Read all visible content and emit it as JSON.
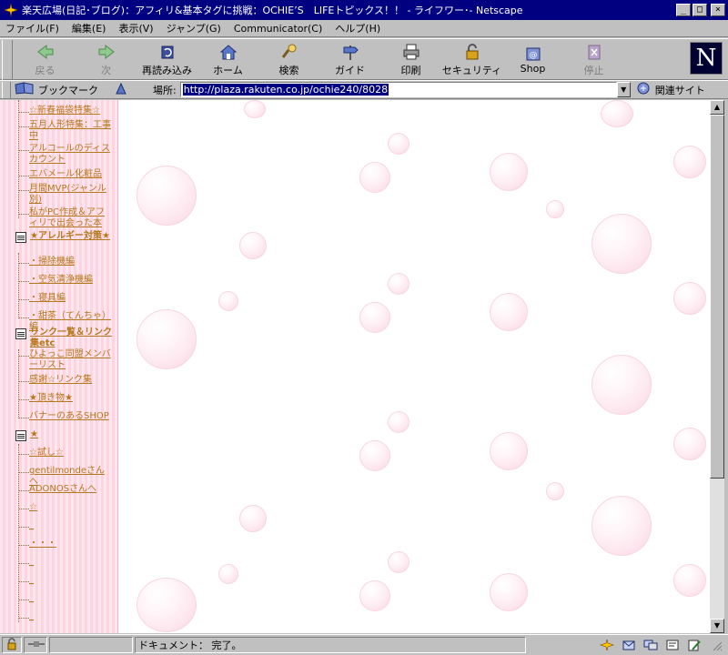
{
  "window": {
    "title": "楽天広場(日記･ブログ)：アフィリ&基本タグに挑戦：OCHIE’S　LIFEトピックス！！ - ライフワー･- Netscape",
    "buttons": {
      "minimize": "_",
      "maximize": "□",
      "close": "×"
    }
  },
  "menu": [
    "ファイル(F)",
    "編集(E)",
    "表示(V)",
    "ジャンプ(G)",
    "Communicator(C)",
    "ヘルプ(H)"
  ],
  "toolbar": {
    "back": "戻る",
    "forward": "次",
    "reload": "再読み込み",
    "home": "ホーム",
    "search": "検索",
    "guide": "ガイド",
    "print": "印刷",
    "security": "セキュリティ",
    "shop": "Shop",
    "stop": "停止",
    "logo": "N"
  },
  "location": {
    "bookmarks": "ブックマーク",
    "label": "場所:",
    "url": "http://plaza.rakuten.co.jp/ochie240/8028",
    "related": "関連サイト"
  },
  "sidebar": {
    "group1": [
      "☆新春福袋特集☆",
      "五月人形特集：工事中",
      "アルコールのディスカウント",
      "エバメール化粧品",
      "月間MVP(ジャンル別)",
      "私がPC作成＆アフィリで出会った本"
    ],
    "heading2": "★アレルギー対策★",
    "group2": [
      "・掃除機編",
      "・空気清浄機編",
      "・寝具編",
      "・甜茶（てんちゃ）編"
    ],
    "heading3": "リンク一覧＆リンク集etc",
    "group3": [
      "ひよっこ同盟メンバーリスト",
      "感謝☆リンク集",
      "★頂き物★",
      "バナーのあるSHOP"
    ],
    "heading4": "★",
    "group4": [
      "☆試し☆",
      "gentilmondeさん へ",
      "ADONOSさんへ",
      "☆",
      "_",
      "・・・",
      "_",
      "_",
      "_",
      "_"
    ]
  },
  "status": {
    "text": "ドキュメント： 完了。"
  },
  "colors": {
    "titlebar": "#000080",
    "sidebar_link": "#b5781c",
    "sidebar_bg": "#ffe7ef"
  }
}
